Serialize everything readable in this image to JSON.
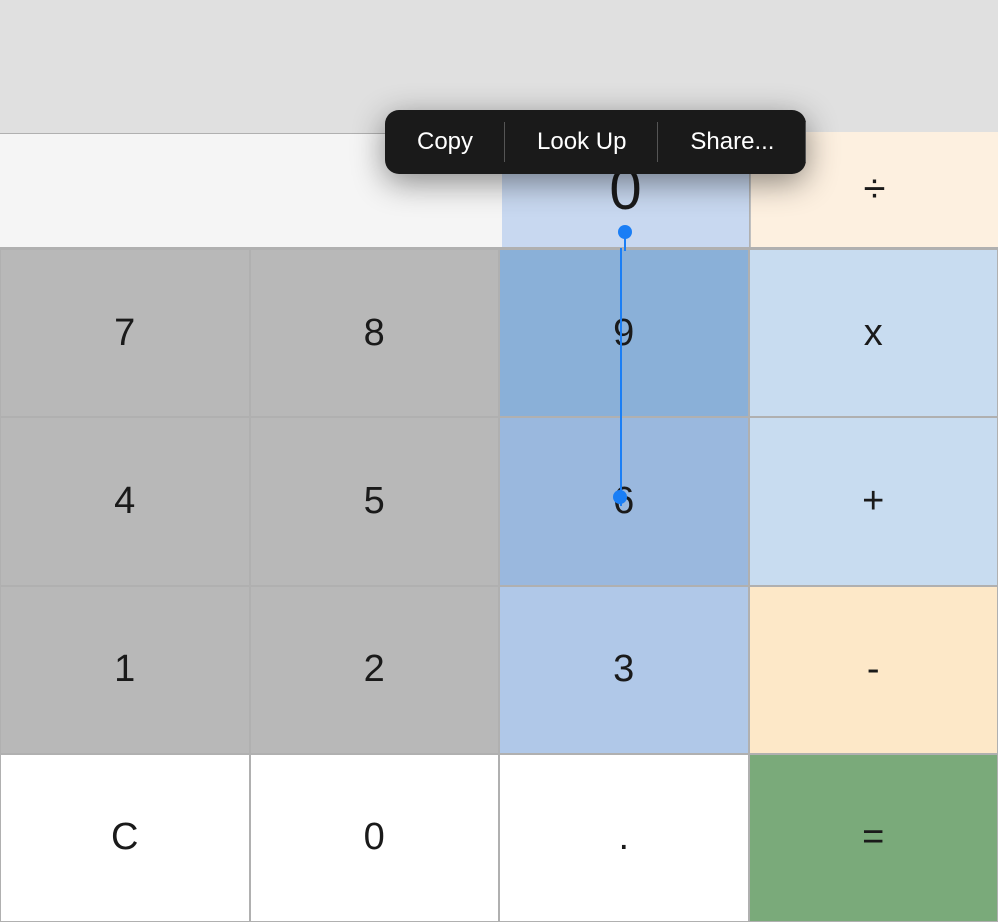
{
  "contextMenu": {
    "items": [
      "Copy",
      "Look Up",
      "Share..."
    ]
  },
  "display": {
    "value": "0",
    "operator": "÷"
  },
  "calculator": {
    "rows": [
      [
        {
          "label": "7",
          "type": "gray"
        },
        {
          "label": "8",
          "type": "gray"
        },
        {
          "label": "9",
          "type": "blue-selected"
        },
        {
          "label": "x",
          "type": "orange-light"
        }
      ],
      [
        {
          "label": "4",
          "type": "gray"
        },
        {
          "label": "5",
          "type": "gray"
        },
        {
          "label": "6",
          "type": "blue"
        },
        {
          "label": "+",
          "type": "orange-light"
        }
      ],
      [
        {
          "label": "1",
          "type": "gray"
        },
        {
          "label": "2",
          "type": "gray"
        },
        {
          "label": "3",
          "type": "blue-faint"
        },
        {
          "label": "-",
          "type": "orange-light"
        }
      ],
      [
        {
          "label": "C",
          "type": "white"
        },
        {
          "label": "0",
          "type": "white"
        },
        {
          "label": ".",
          "type": "white"
        },
        {
          "label": "=",
          "type": "green"
        }
      ]
    ]
  }
}
